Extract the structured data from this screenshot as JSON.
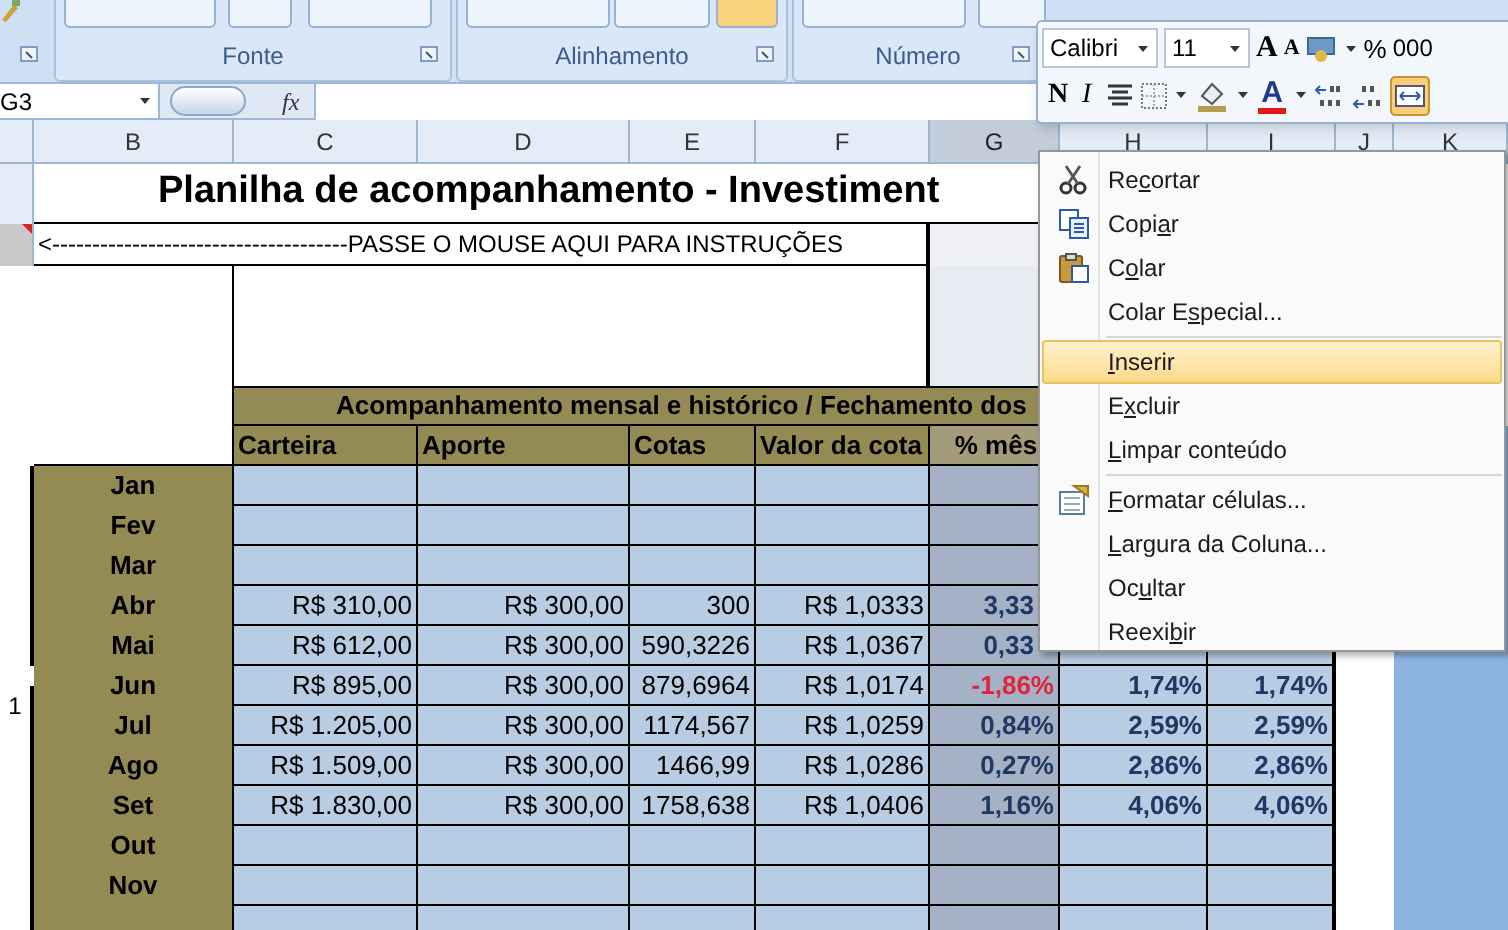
{
  "ribbon": {
    "groups": [
      {
        "label": "Fonte"
      },
      {
        "label": "Alinhamento"
      },
      {
        "label": "Número"
      }
    ]
  },
  "formula_bar": {
    "name_box": "G3",
    "function_label": "fx"
  },
  "columns": [
    {
      "label": "B",
      "selected": false
    },
    {
      "label": "C",
      "selected": false
    },
    {
      "label": "D",
      "selected": false
    },
    {
      "label": "E",
      "selected": false
    },
    {
      "label": "F",
      "selected": false
    },
    {
      "label": "G",
      "selected": true
    },
    {
      "label": "H",
      "selected": false
    },
    {
      "label": "I",
      "selected": false
    },
    {
      "label": "J",
      "selected": false
    },
    {
      "label": "K",
      "selected": false
    }
  ],
  "sheet": {
    "title": "Planilha de acompanhamento - Investiment",
    "instructions": "<-------------------------------------PASSE O MOUSE AQUI PARA INSTRUÇÕES",
    "table_title": "Acompanhamento mensal e histórico / Fechamento dos",
    "headers": [
      "Carteira",
      "Aporte",
      "Cotas",
      "Valor da cota",
      "% mês"
    ],
    "rows": [
      {
        "month": "Jan"
      },
      {
        "month": "Fev"
      },
      {
        "month": "Mar"
      },
      {
        "month": "Abr",
        "carteira": "R$ 310,00",
        "aporte": "R$ 300,00",
        "cotas": "300",
        "valor_cota": "R$ 1,0333",
        "pct_mes": "3,33",
        "clipped": true,
        "negative": false
      },
      {
        "month": "Mai",
        "carteira": "R$ 612,00",
        "aporte": "R$ 300,00",
        "cotas": "590,3226",
        "valor_cota": "R$ 1,0367",
        "pct_mes": "0,33",
        "clipped": true,
        "negative": false
      },
      {
        "month": "Jun",
        "row_header": "1",
        "carteira": "R$ 895,00",
        "aporte": "R$ 300,00",
        "cotas": "879,6964",
        "valor_cota": "R$ 1,0174",
        "pct_mes": "-1,86%",
        "clipped": false,
        "negative": true,
        "column_h": "1,74%",
        "column_i": "1,74%"
      },
      {
        "month": "Jul",
        "carteira": "R$ 1.205,00",
        "aporte": "R$ 300,00",
        "cotas": "1174,567",
        "valor_cota": "R$ 1,0259",
        "pct_mes": "0,84%",
        "clipped": false,
        "negative": false,
        "column_h": "2,59%",
        "column_i": "2,59%"
      },
      {
        "month": "Ago",
        "carteira": "R$ 1.509,00",
        "aporte": "R$ 300,00",
        "cotas": "1466,99",
        "valor_cota": "R$ 1,0286",
        "pct_mes": "0,27%",
        "clipped": false,
        "negative": false,
        "column_h": "2,86%",
        "column_i": "2,86%"
      },
      {
        "month": "Set",
        "carteira": "R$ 1.830,00",
        "aporte": "R$ 300,00",
        "cotas": "1758,638",
        "valor_cota": "R$ 1,0406",
        "pct_mes": "1,16%",
        "clipped": false,
        "negative": false,
        "column_h": "4,06%",
        "column_i": "4,06%"
      },
      {
        "month": "Out"
      },
      {
        "month": "Nov"
      },
      {}
    ]
  },
  "mini_toolbar": {
    "font": "Calibri",
    "size": "11",
    "grow_font": "A",
    "shrink_font": "A",
    "percent": "%",
    "thousands": "000",
    "bold": "N",
    "italic": "I",
    "font_color": "A"
  },
  "context_menu": {
    "items": [
      {
        "before": "Re",
        "key": "c",
        "after": "ortar",
        "selected": false,
        "separator_after": false
      },
      {
        "before": "Copi",
        "key": "a",
        "after": "r",
        "selected": false,
        "separator_after": false
      },
      {
        "before": "C",
        "key": "o",
        "after": "lar",
        "selected": false,
        "separator_after": false
      },
      {
        "before": "Colar E",
        "key": "s",
        "after": "pecial...",
        "selected": false,
        "separator_after": true
      },
      {
        "key": "I",
        "after": "nserir",
        "selected": true,
        "separator_after": false
      },
      {
        "before": "E",
        "key": "x",
        "after": "cluir",
        "selected": false,
        "separator_after": false
      },
      {
        "key": "L",
        "after": "impar conteúdo",
        "selected": false,
        "separator_after": true
      },
      {
        "key": "F",
        "after": "ormatar células...",
        "selected": false,
        "separator_after": false
      },
      {
        "key": "L",
        "after": "argura da Coluna...",
        "selected": false,
        "separator_after": false
      },
      {
        "before": "Oc",
        "key": "u",
        "after": "ltar",
        "selected": false,
        "separator_after": false
      },
      {
        "before": "Reexi",
        "key": "b",
        "after": "ir",
        "selected": false,
        "separator_after": false
      }
    ]
  }
}
